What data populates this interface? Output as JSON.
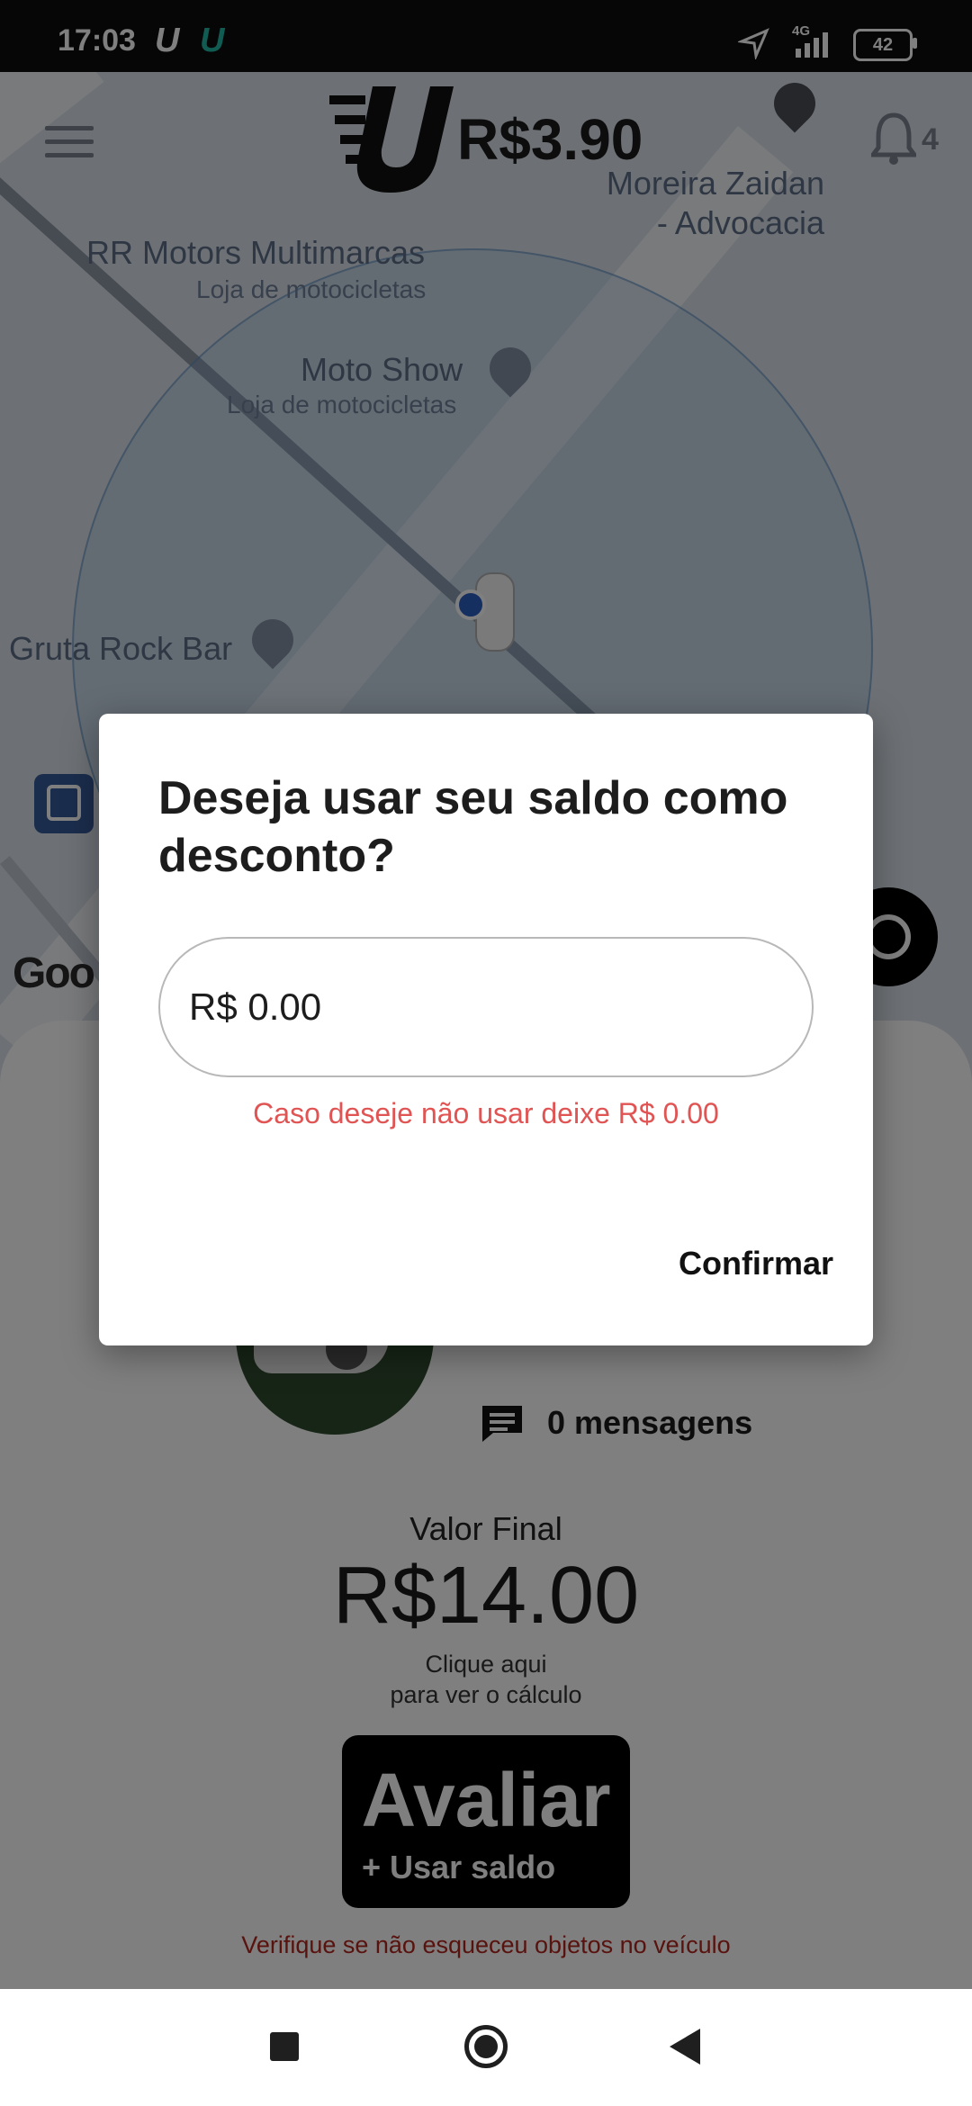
{
  "status_bar": {
    "time": "17:03",
    "network": "4G",
    "battery": "42"
  },
  "header": {
    "price": "R$3.90",
    "notification_count": "4"
  },
  "map": {
    "pois": [
      {
        "name": "Moreira Zaidan",
        "name2": "- Advocacia",
        "subtitle": ""
      },
      {
        "name": "RR Motors Multimarcas",
        "subtitle": "Loja de motocicletas"
      },
      {
        "name": "Moto Show",
        "subtitle": "Loja de motocicletas"
      },
      {
        "name": "Gruta Rock Bar",
        "subtitle": ""
      }
    ],
    "attribution": "Goo"
  },
  "ride": {
    "messages": "0 mensagens",
    "final_label": "Valor Final",
    "final_value": "R$14.00",
    "calc_hint_1": "Clique aqui",
    "calc_hint_2": "para ver o cálculo",
    "rate_button": "Avaliar",
    "rate_button_sub": "+ Usar saldo",
    "warning": "Verifique se não esqueceu objetos no veículo"
  },
  "dialog": {
    "title": "Deseja usar seu saldo como desconto?",
    "input_value": "R$ 0.00",
    "hint": "Caso deseje não usar deixe R$ 0.00",
    "confirm": "Confirmar"
  },
  "colors": {
    "accent_teal": "#22b8a4",
    "hint_red": "#e05454",
    "warning_red": "#b3261e"
  }
}
